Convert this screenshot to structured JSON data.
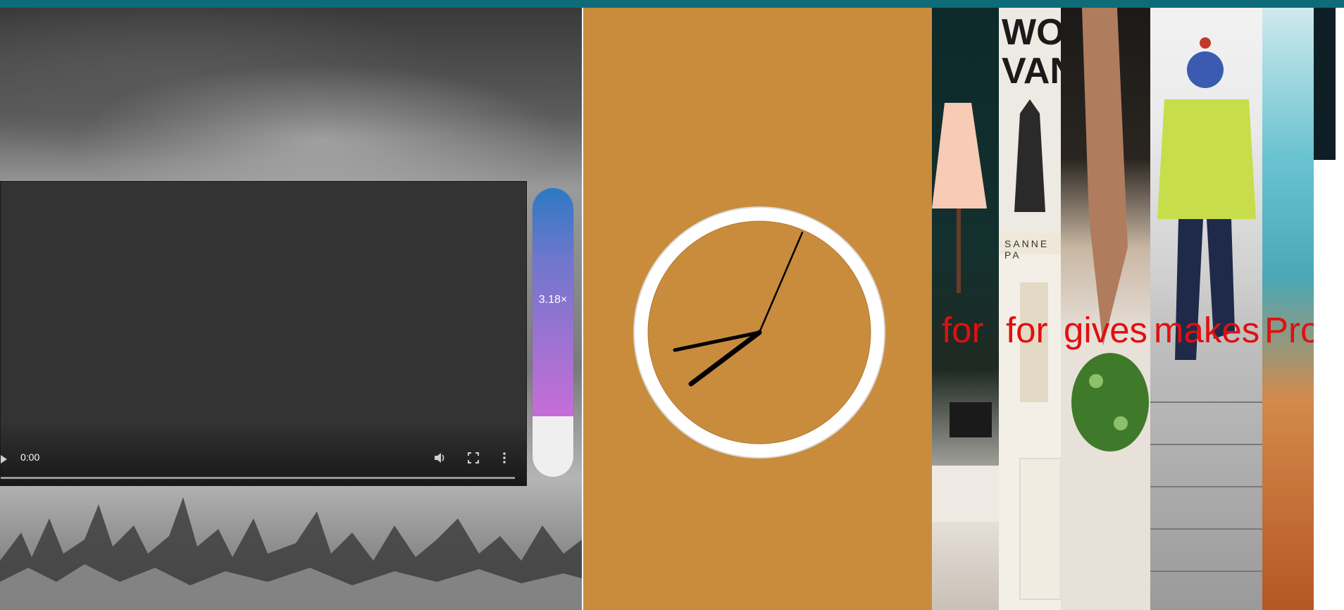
{
  "video": {
    "current_time": "0:00"
  },
  "speed_slider": {
    "label": "3.18×",
    "level_fraction": 0.79,
    "gradient_colors": [
      "#2c79c3",
      "#c66dd7"
    ]
  },
  "clock": {
    "face_color": "#c98c3d",
    "rim_color": "#ffffff",
    "hand_color": "#000000"
  },
  "gallery": {
    "book_title_lines": [
      "WOLF",
      "VANDE"
    ],
    "author_fragment": "SANNE PA",
    "overlay_words": [
      "for",
      "for",
      "gives",
      "makes",
      "Pro"
    ],
    "overlay_color": "#e01010"
  },
  "colors": {
    "topbar": "#0e6b78",
    "middle_background": "#c98c3d",
    "right_background": "#0d1f24"
  }
}
